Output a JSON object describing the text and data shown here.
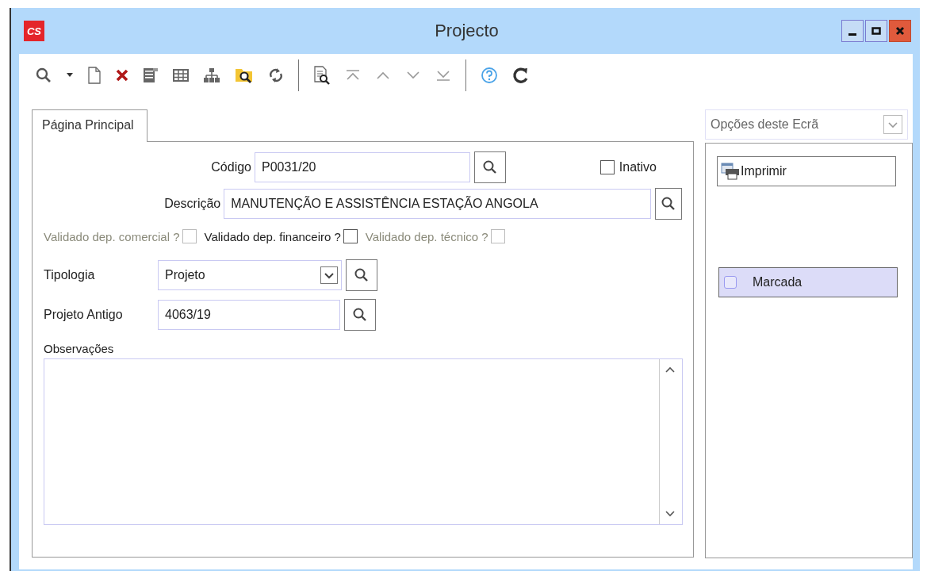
{
  "window": {
    "logo": "CS",
    "title": "Projecto"
  },
  "tabs": [
    {
      "label": "Página Principal",
      "selected": true
    }
  ],
  "form": {
    "codigo": {
      "label": "Código",
      "value": "P0031/20"
    },
    "inativo": {
      "label": "Inativo",
      "checked": false
    },
    "descricao": {
      "label": "Descrição",
      "value": "MANUTENÇÃO E ASSISTÊNCIA ESTAÇÃO ANGOLA"
    },
    "validations": [
      {
        "label": "Validado dep. comercial ?",
        "checked": false,
        "disabled": true
      },
      {
        "label": "Validado dep. financeiro ?",
        "checked": false,
        "disabled": false
      },
      {
        "label": "Validado dep. técnico ?",
        "checked": false,
        "disabled": true
      }
    ],
    "tipologia": {
      "label": "Tipologia",
      "value": "Projeto"
    },
    "projeto_antigo": {
      "label": "Projeto Antigo",
      "value": "4063/19"
    },
    "observacoes": {
      "label": "Observações"
    }
  },
  "options": {
    "dropdown": "Opções deste Ecrã",
    "print_button": "Imprimir",
    "marcada": {
      "label": "Marcada",
      "checked": false
    }
  }
}
